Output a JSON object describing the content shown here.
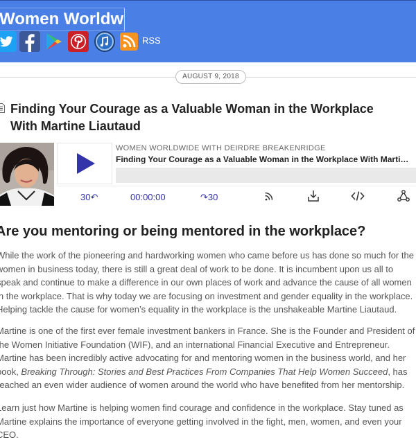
{
  "header": {
    "site_title": "Women Worldwide",
    "social": [
      {
        "icon": "twitter-icon",
        "color": "#1da1f2"
      },
      {
        "icon": "facebook-icon",
        "color": "#3b5998"
      },
      {
        "icon": "google-play-icon",
        "color": "#4a7fe6"
      },
      {
        "icon": "pinterest-icon",
        "color": "#cb2027"
      },
      {
        "icon": "itunes-icon",
        "color": "#1c3f73"
      },
      {
        "icon": "rss-icon",
        "color": "#f7931e"
      }
    ],
    "rss_label": "RSS"
  },
  "post": {
    "date": "AUGUST 9, 2018",
    "title_line1": "Finding Your Courage as a Valuable Woman in the Workplace",
    "title_line2": "With Martine Liautaud"
  },
  "player": {
    "podcast_name": "WOMEN WORLDWIDE WITH DEIRDRE BREAKENRIDGE",
    "episode_title": "Finding Your Courage as a Valuable Woman in the Workplace With Martine Liautaud",
    "rewind_label": "30↶",
    "time": "00:00:00",
    "forward_label": "↷30",
    "accent_color": "#3333aa"
  },
  "content": {
    "heading": "Are you mentoring or being mentored in the workplace?",
    "p1": "While the work of the pioneering and hardworking women who came before us has done so much for the women in business today, there is still a great deal of work to be done. It is incumbent upon us all to speak and continue to make a difference in our own places of work and advance the cause of all women in the workplace. That is why today we are focusing on investment and gender equality in the workplace. Helping tackle the cause for women’s equality in the workplace is the unshakeable Martine Liautaud.",
    "p2_a": "Martine is one of the first ever female investment bankers in France. She is the Founder and President of the Women Initiative Foundation (WIF), and an international Financial Executive and Entrepreneur. Martine has been incredibly active advocating for and mentoring women in the business world, and her book, ",
    "p2_book": "Breaking Through: Stories and Best Practices From Companies That Help Women Succeed",
    "p2_b": ", has reached an even wider audience of women around the world who have benefited from her mentorship.",
    "p3": "Learn just how Martine is helping women find courage and confidence in the workplace. Stay tuned as Martine explains the importance of everyone getting involved in the fight, men, women, and even your CEO."
  }
}
